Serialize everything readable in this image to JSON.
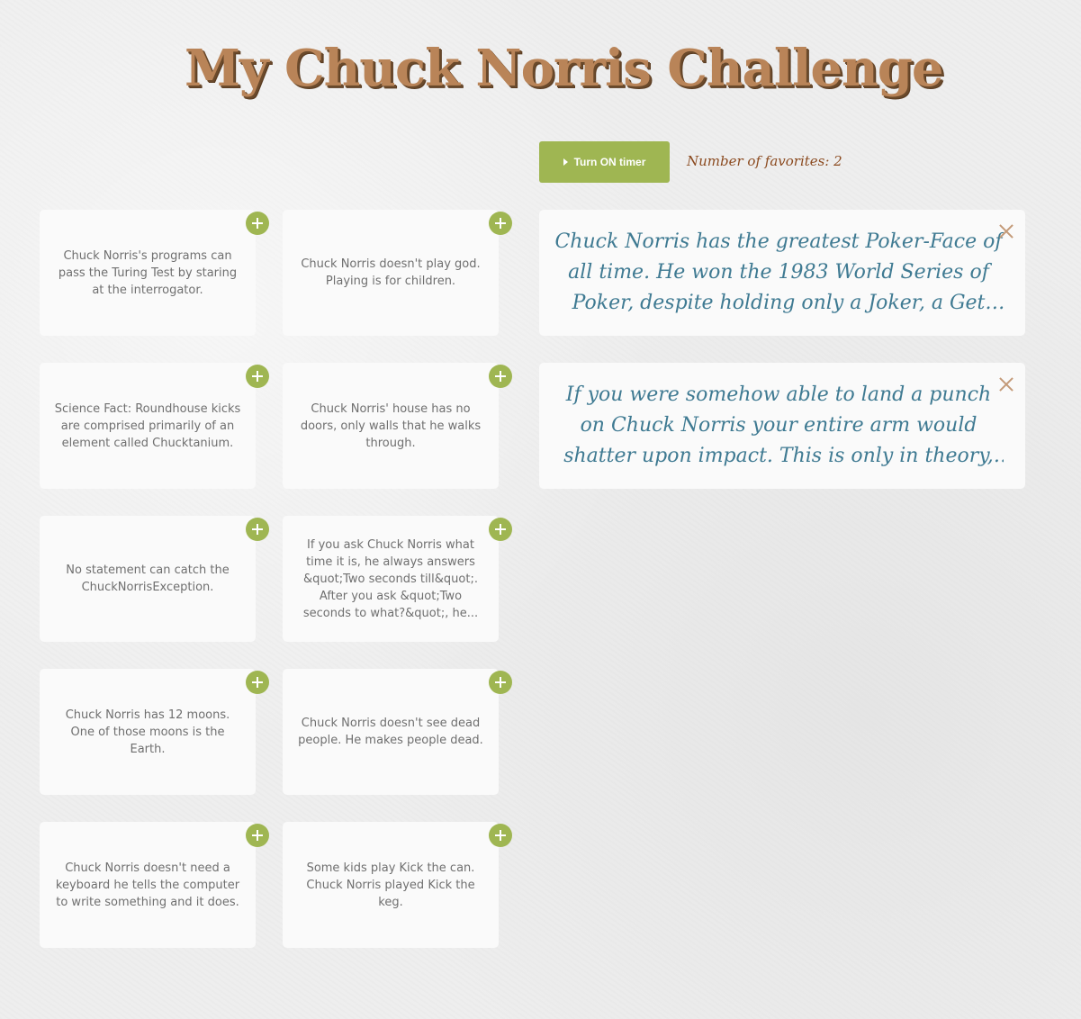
{
  "header": {
    "title": "My Chuck Norris Challenge"
  },
  "controls": {
    "timer_button_label": "Turn ON timer",
    "favorites_count_text": "Number of favorites: 2"
  },
  "jokes": [
    {
      "text": "Chuck Norris's programs can pass the Turing Test by staring at the interrogator."
    },
    {
      "text": "Chuck Norris doesn't play god. Playing is for children."
    },
    {
      "text": "Science Fact: Roundhouse kicks are comprised primarily of an element called Chucktanium."
    },
    {
      "text": "Chuck Norris' house has no doors, only walls that he walks through."
    },
    {
      "text": "No statement can catch the ChuckNorrisException."
    },
    {
      "text": "If you ask Chuck Norris what time it is, he always answers &quot;Two seconds till&quot;. After you ask &quot;Two seconds to what?&quot;, he..."
    },
    {
      "text": "Chuck Norris has 12 moons. One of those moons is the Earth."
    },
    {
      "text": "Chuck Norris doesn't see dead people. He makes people dead."
    },
    {
      "text": "Chuck Norris doesn't need a keyboard he tells the computer to write something and it does."
    },
    {
      "text": "Some kids play Kick the can. Chuck Norris played Kick the keg."
    }
  ],
  "favorites": [
    {
      "text": "Chuck Norris has the greatest Poker-Face of all time. He won the 1983 World Series of Poker, despite holding only a Joker, a Get out of Jail..."
    },
    {
      "text": "If you were somehow able to land a punch on Chuck Norris your entire arm would shatter upon impact. This is only in theory, since, com..."
    }
  ],
  "colors": {
    "accent_green": "#9fb652",
    "title_brown": "#b98458",
    "favorite_text_blue": "#3f7a92",
    "count_text_brown": "#8b4a1f"
  },
  "icons": {
    "add": "plus-icon",
    "remove": "close-icon",
    "timer": "play-icon"
  }
}
